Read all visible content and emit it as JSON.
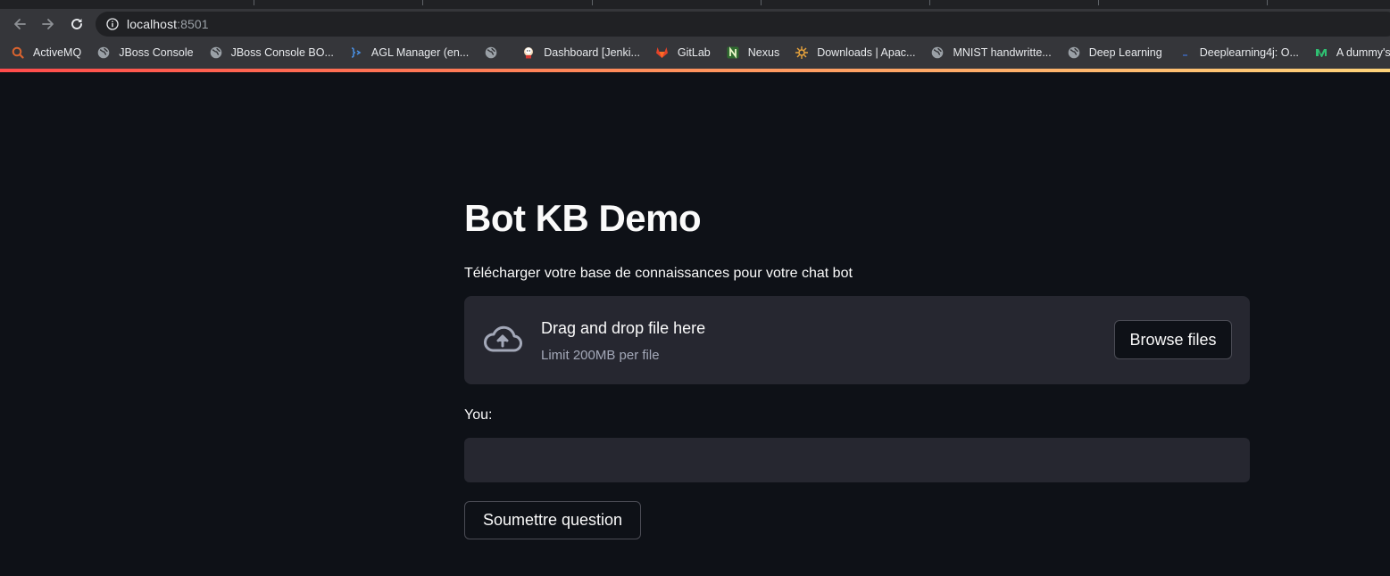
{
  "browser": {
    "url_host": "localhost",
    "url_port": ":8501",
    "bookmarks": [
      {
        "label": "ActiveMQ",
        "icon": "activemq-icon"
      },
      {
        "label": "JBoss Console",
        "icon": "globe-icon"
      },
      {
        "label": "JBoss Console BO...",
        "icon": "globe-icon"
      },
      {
        "label": "AGL Manager (en...",
        "icon": "code-bracket-icon"
      },
      {
        "label": "",
        "icon": "globe-icon"
      },
      {
        "label": "Dashboard [Jenki...",
        "icon": "jenkins-icon"
      },
      {
        "label": "GitLab",
        "icon": "gitlab-icon"
      },
      {
        "label": "Nexus",
        "icon": "nexus-icon"
      },
      {
        "label": "Downloads | Apac...",
        "icon": "apache-icon"
      },
      {
        "label": "MNIST handwritte...",
        "icon": "globe-icon"
      },
      {
        "label": "Deep Learning",
        "icon": "globe-icon"
      },
      {
        "label": "Deeplearning4j: O...",
        "icon": "dl4j-icon"
      },
      {
        "label": "A dummy's guid",
        "icon": "medium-icon"
      }
    ]
  },
  "app": {
    "title": "Bot KB Demo",
    "uploader": {
      "label": "Télécharger votre base de connaissances pour votre chat bot",
      "drop_title": "Drag and drop file here",
      "drop_limit": "Limit 200MB per file",
      "browse_label": "Browse files"
    },
    "question": {
      "label": "You:",
      "value": "",
      "submit_label": "Soumettre question"
    }
  },
  "colors": {
    "app_background": "#0e1117",
    "widget_background": "#262730",
    "accent_gradient_start": "#ff4b4b",
    "accent_gradient_end": "#fdd37a"
  }
}
